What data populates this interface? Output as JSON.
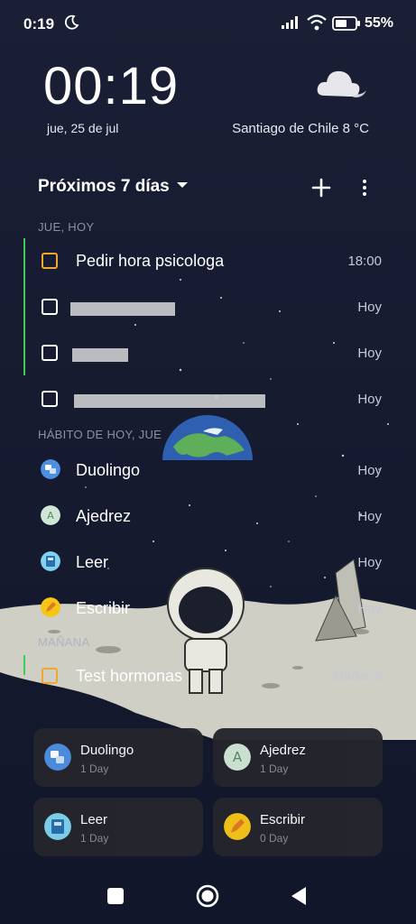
{
  "status_bar": {
    "time": "0:19",
    "battery": "55%"
  },
  "clock_widget": {
    "time": "00:19",
    "date": "jue, 25 de jul",
    "weather": "Santiago de Chile 8 °C",
    "weather_icon": "cloud-moon-icon"
  },
  "task_widget": {
    "title": "Próximos 7 días",
    "section_today": "JUE, HOY",
    "section_habits": "HÁBITO DE HOY, JUE",
    "section_tomorrow": "MAÑANA",
    "tasks": [
      {
        "title": "Pedir hora psicologa",
        "due": "18:00"
      },
      {
        "title": "",
        "due": "Hoy"
      },
      {
        "title": "",
        "due": "Hoy"
      },
      {
        "title": "",
        "due": "Hoy"
      }
    ],
    "habits": [
      {
        "title": "Duolingo",
        "due": "Hoy"
      },
      {
        "title": "Ajedrez",
        "due": "Hoy"
      },
      {
        "title": "Leer",
        "due": "Hoy"
      },
      {
        "title": "Escribir",
        "due": "Hoy"
      }
    ],
    "tomorrow_tasks": [
      {
        "title": "Test hormonas",
        "due": "Mañana"
      }
    ]
  },
  "habit_cards": [
    {
      "name": "Duolingo",
      "streak": "1 Day",
      "icon": "translate-icon",
      "color": "#4d8fe0"
    },
    {
      "name": "Ajedrez",
      "streak": "1 Day",
      "icon": "letter-a-icon",
      "color": "#cfe6d6"
    },
    {
      "name": "Leer",
      "streak": "1 Day",
      "icon": "book-icon",
      "color": "#7fd3ee"
    },
    {
      "name": "Escribir",
      "streak": "0 Day",
      "icon": "pencil-icon",
      "color": "#f5c518"
    }
  ],
  "colors": {
    "accent_green": "#3ccf55",
    "checkbox_orange": "#f2a62a",
    "card_bg": "#25262d"
  }
}
